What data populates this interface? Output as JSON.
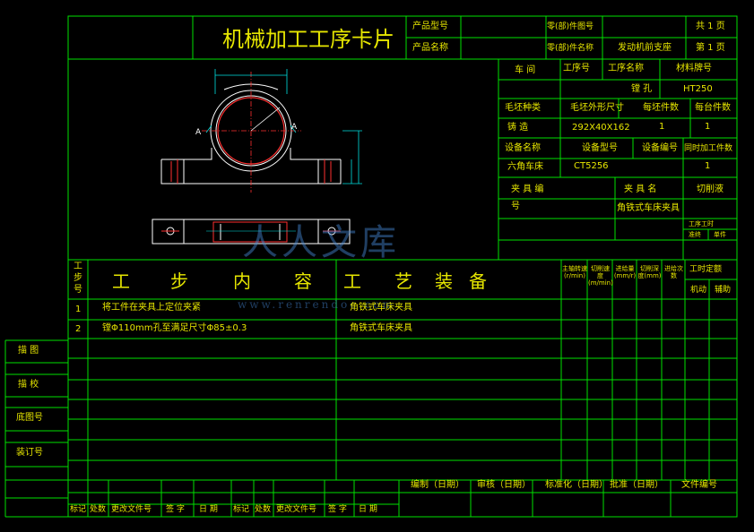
{
  "card": {
    "title": "机械加工工序卡片",
    "product_model_label": "产品型号",
    "product_name_label": "产品名称",
    "part_no_label": "零(部)件图号",
    "part_name_label": "零(部)件名称",
    "part_name": "发动机前支座",
    "total_pages": "共 1 页",
    "page_no": "第 1 页"
  },
  "process": {
    "workshop_label": "车 间",
    "op_no_label": "工序号",
    "op_name_label": "工序名称",
    "material_label": "材料牌号",
    "op_name": "镗 孔",
    "material": "HT250",
    "blank_type_label": "毛坯种类",
    "blank_size_label": "毛坯外形尺寸",
    "per_blank_label": "每坯件数",
    "per_unit_label": "每台件数",
    "blank_type": "铸 造",
    "blank_size": "292X40X162",
    "per_blank": "1",
    "per_unit": "1",
    "equip_name_label": "设备名称",
    "equip_model_label": "设备型号",
    "equip_no_label": "设备编号",
    "simul_label": "同时加工件数",
    "equip_name": "六角车床",
    "equip_model": "CT5256",
    "simul": "1",
    "fixture_no_label": "夹 具 编",
    "fixture_no_label2": "号",
    "fixture_name_label": "夹 具 名",
    "fixture_name": "角铁式车床夹具",
    "coolant_label": "切削液",
    "time_label": "工序工时",
    "time_prep": "准终",
    "time_unit": "单件"
  },
  "steps_header": {
    "step_label": "工步号",
    "content_label": [
      "工",
      "步",
      "内",
      "容"
    ],
    "equip_label": [
      "工",
      "艺",
      "装",
      "备"
    ],
    "spindle": "主轴转速(r/min)",
    "speed": "切削速度(m/min)",
    "feed": "进给量(mm/r)",
    "depth": "切削深度(mm)",
    "passes": "进给次数",
    "time_quota": "工时定额",
    "time_machine": "机动",
    "time_aux": "辅助"
  },
  "steps": [
    {
      "no": "1",
      "content": "将工件在夹具上定位夹紧",
      "equip": "角铁式车床夹具"
    },
    {
      "no": "2",
      "content": "镗Φ110mm孔至满足尺寸Φ85±0.3",
      "equip": "角铁式车床夹具"
    }
  ],
  "side_labels": [
    "描 图",
    "描 校",
    "底图号",
    "装订号"
  ],
  "footer": {
    "design": "编制（日期）",
    "review": "审核（日期）",
    "standard": "标准化（日期）",
    "approve": "批准（日期）",
    "doc_no": "文件编号",
    "row_labels": [
      "标记",
      "处数",
      "更改文件号",
      "签 字",
      "日 期",
      "标记",
      "处数",
      "更改文件号",
      "签 字",
      "日 期"
    ]
  },
  "drawing": {
    "label_a1": "A",
    "label_a2": "A"
  },
  "watermark": {
    "logo": "人人文库",
    "url": "www.renrendoc.com"
  },
  "colors": {
    "frame": "#00e000",
    "text": "#e6e600",
    "part": "#ffffff",
    "center": "#ff3030",
    "dim": "#00e0e0"
  }
}
